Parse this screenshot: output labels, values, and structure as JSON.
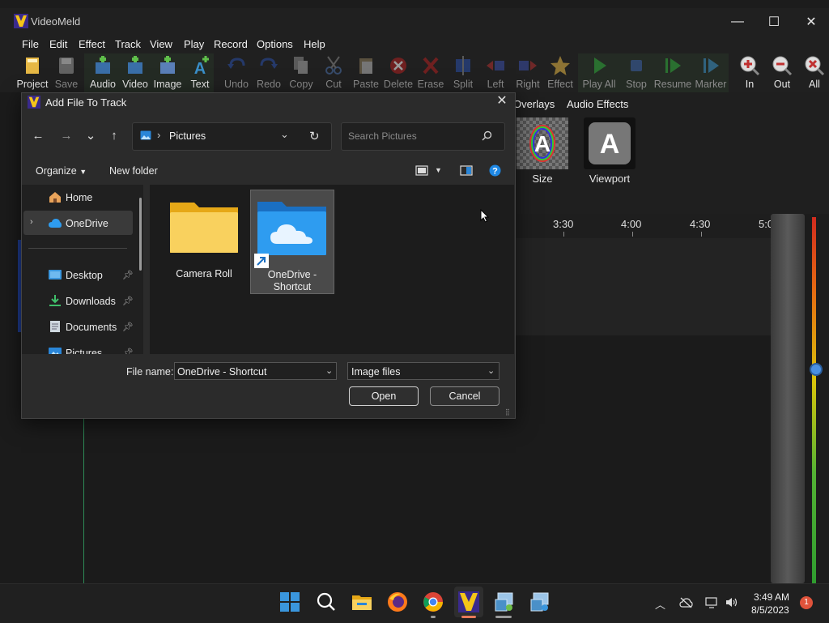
{
  "app": {
    "title": "VideoMeld",
    "window_controls": {
      "minimize": "—",
      "maximize": "☐",
      "close": "✕"
    }
  },
  "menu": [
    "File",
    "Edit",
    "Effect",
    "Track",
    "View",
    "Play",
    "Record",
    "Options",
    "Help"
  ],
  "toolbar": [
    {
      "label": "Project",
      "icon": "project-icon",
      "enabled": true
    },
    {
      "label": "Save",
      "icon": "save-icon",
      "enabled": false
    },
    {
      "label": "Audio",
      "icon": "add-audio-icon",
      "enabled": true
    },
    {
      "label": "Video",
      "icon": "add-video-icon",
      "enabled": true
    },
    {
      "label": "Image",
      "icon": "add-image-icon",
      "enabled": true
    },
    {
      "label": "Text",
      "icon": "add-text-icon",
      "enabled": true
    },
    {
      "label": "Undo",
      "icon": "undo-icon",
      "enabled": false
    },
    {
      "label": "Redo",
      "icon": "redo-icon",
      "enabled": false
    },
    {
      "label": "Copy",
      "icon": "copy-icon",
      "enabled": false
    },
    {
      "label": "Cut",
      "icon": "cut-icon",
      "enabled": false
    },
    {
      "label": "Paste",
      "icon": "paste-icon",
      "enabled": false
    },
    {
      "label": "Delete",
      "icon": "delete-icon",
      "enabled": false
    },
    {
      "label": "Erase",
      "icon": "erase-icon",
      "enabled": false
    },
    {
      "label": "Split",
      "icon": "split-icon",
      "enabled": false
    },
    {
      "label": "Left",
      "icon": "move-left-icon",
      "enabled": false
    },
    {
      "label": "Right",
      "icon": "move-right-icon",
      "enabled": false
    },
    {
      "label": "Effect",
      "icon": "effect-star-icon",
      "enabled": false
    },
    {
      "label": "Play All",
      "icon": "play-icon",
      "enabled": false
    },
    {
      "label": "Stop",
      "icon": "stop-icon",
      "enabled": false
    },
    {
      "label": "Resume",
      "icon": "resume-icon",
      "enabled": false
    },
    {
      "label": "Marker",
      "icon": "marker-icon",
      "enabled": false
    },
    {
      "label": "In",
      "icon": "zoom-in-icon",
      "enabled": true
    },
    {
      "label": "Out",
      "icon": "zoom-out-icon",
      "enabled": true
    },
    {
      "label": "All",
      "icon": "zoom-all-icon",
      "enabled": true
    }
  ],
  "effects_panel": {
    "tabs": [
      "Overlays",
      "Audio Effects"
    ],
    "items": [
      {
        "label": "Size",
        "icon": "size-effect-icon"
      },
      {
        "label": "Viewport",
        "icon": "viewport-effect-icon"
      }
    ]
  },
  "timeline": {
    "ticks": [
      "3:30",
      "4:00",
      "4:30",
      "5:0"
    ]
  },
  "dialog": {
    "title": "Add File To Track",
    "close": "✕",
    "nav": {
      "back": "←",
      "forward": "→",
      "recent": "⌄",
      "up": "↑"
    },
    "address": {
      "location": "Pictures",
      "separator": "›",
      "dropdown": "⌄",
      "refresh": "↻"
    },
    "search": {
      "placeholder": "Search Pictures"
    },
    "commands": {
      "organize": "Organize",
      "new_folder": "New folder"
    },
    "nav_pane": [
      {
        "label": "Home",
        "icon": "home-icon",
        "pinned": false,
        "expandable": false,
        "selected": false
      },
      {
        "label": "OneDrive",
        "icon": "onedrive-icon",
        "pinned": false,
        "expandable": true,
        "selected": true
      },
      {
        "label": "Desktop",
        "icon": "desktop-folder-icon",
        "pinned": true,
        "expandable": false,
        "selected": false
      },
      {
        "label": "Downloads",
        "icon": "downloads-folder-icon",
        "pinned": true,
        "expandable": false,
        "selected": false
      },
      {
        "label": "Documents",
        "icon": "documents-folder-icon",
        "pinned": true,
        "expandable": false,
        "selected": false
      },
      {
        "label": "Pictures",
        "icon": "pictures-folder-icon",
        "pinned": true,
        "expandable": false,
        "selected": false
      }
    ],
    "files": [
      {
        "label": "Camera Roll",
        "icon": "folder-icon",
        "selected": false
      },
      {
        "label": "OneDrive -\nShortcut",
        "icon": "onedrive-folder-shortcut-icon",
        "selected": true
      }
    ],
    "file_name_label": "File name:",
    "file_name_value": "OneDrive - Shortcut",
    "file_type_value": "Image files",
    "open_label": "Open",
    "cancel_label": "Cancel"
  },
  "taskbar": {
    "apps": [
      "start-icon",
      "search-icon",
      "file-explorer-icon",
      "firefox-icon",
      "chrome-icon",
      "videomeld-icon",
      "app-icon-1",
      "app-icon-2"
    ],
    "time": "3:49 AM",
    "date": "8/5/2023",
    "notifications": "1"
  },
  "colors": {
    "accent_green": "#3cb043",
    "accent_blue": "#1e90ff",
    "accent_red": "#d12b1e",
    "selection": "#4a4a4a"
  }
}
